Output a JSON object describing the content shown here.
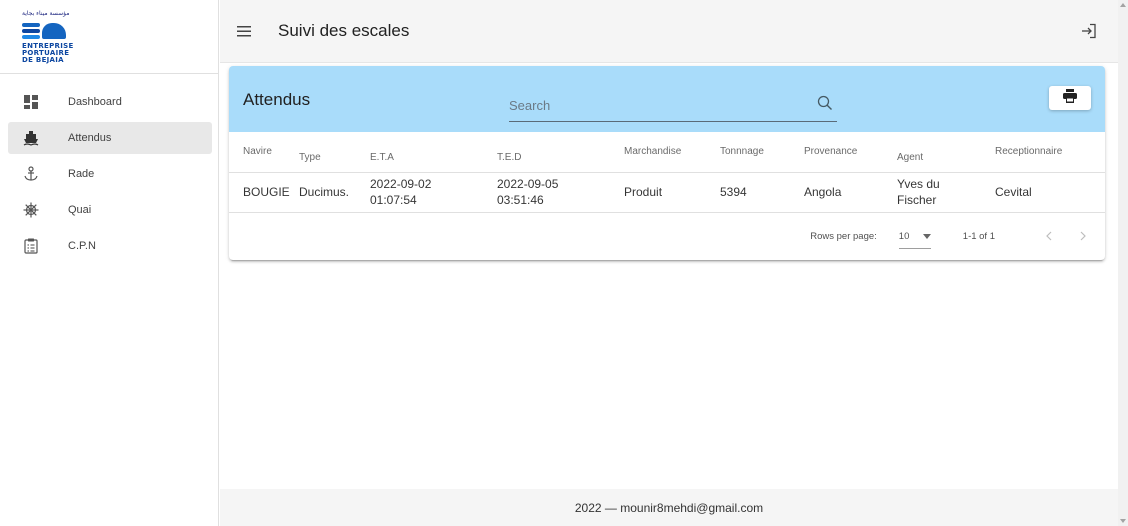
{
  "logo": {
    "arabic": "مؤسسة ميناء بجاية",
    "line1": "ENTREPRISE",
    "line2": "PORTUAIRE",
    "line3": "DE BEJAIA"
  },
  "sidebar": {
    "items": [
      {
        "label": "Dashboard",
        "icon": "dashboard-icon",
        "active": false
      },
      {
        "label": "Attendus",
        "icon": "ship-icon",
        "active": true
      },
      {
        "label": "Rade",
        "icon": "anchor-icon",
        "active": false
      },
      {
        "label": "Quai",
        "icon": "ship-wheel-icon",
        "active": false
      },
      {
        "label": "C.P.N",
        "icon": "clipboard-list-icon",
        "active": false
      }
    ]
  },
  "topbar": {
    "title": "Suivi des escales",
    "menu_icon": "hamburger-menu-icon",
    "logout_icon": "logout-icon"
  },
  "card": {
    "title": "Attendus",
    "search_placeholder": "Search",
    "print_icon": "printer-icon",
    "header_color": "#a9dcfa"
  },
  "table": {
    "columns": [
      "Navire",
      "Type",
      "E.T.A",
      "T.E.D",
      "Marchandise",
      "Tonnnage",
      "Provenance",
      "Agent",
      "Receptionnaire"
    ],
    "rows": [
      {
        "navire": "BOUGIE",
        "type": "Ducimus.",
        "eta_date": "2022-09-02",
        "eta_time": "01:07:54",
        "ted_date": "2022-09-05",
        "ted_time": "03:51:46",
        "marchandise": "Produit",
        "tonnage": "5394",
        "provenance": "Angola",
        "agent_line1": "Yves du",
        "agent_line2": "Fischer",
        "receptionnaire": "Cevital"
      }
    ]
  },
  "pagination": {
    "rows_per_page_label": "Rows per page:",
    "rows_per_page_value": "10",
    "range": "1-1 of 1"
  },
  "footer": {
    "text": "2022 — mounir8mehdi@gmail.com"
  }
}
